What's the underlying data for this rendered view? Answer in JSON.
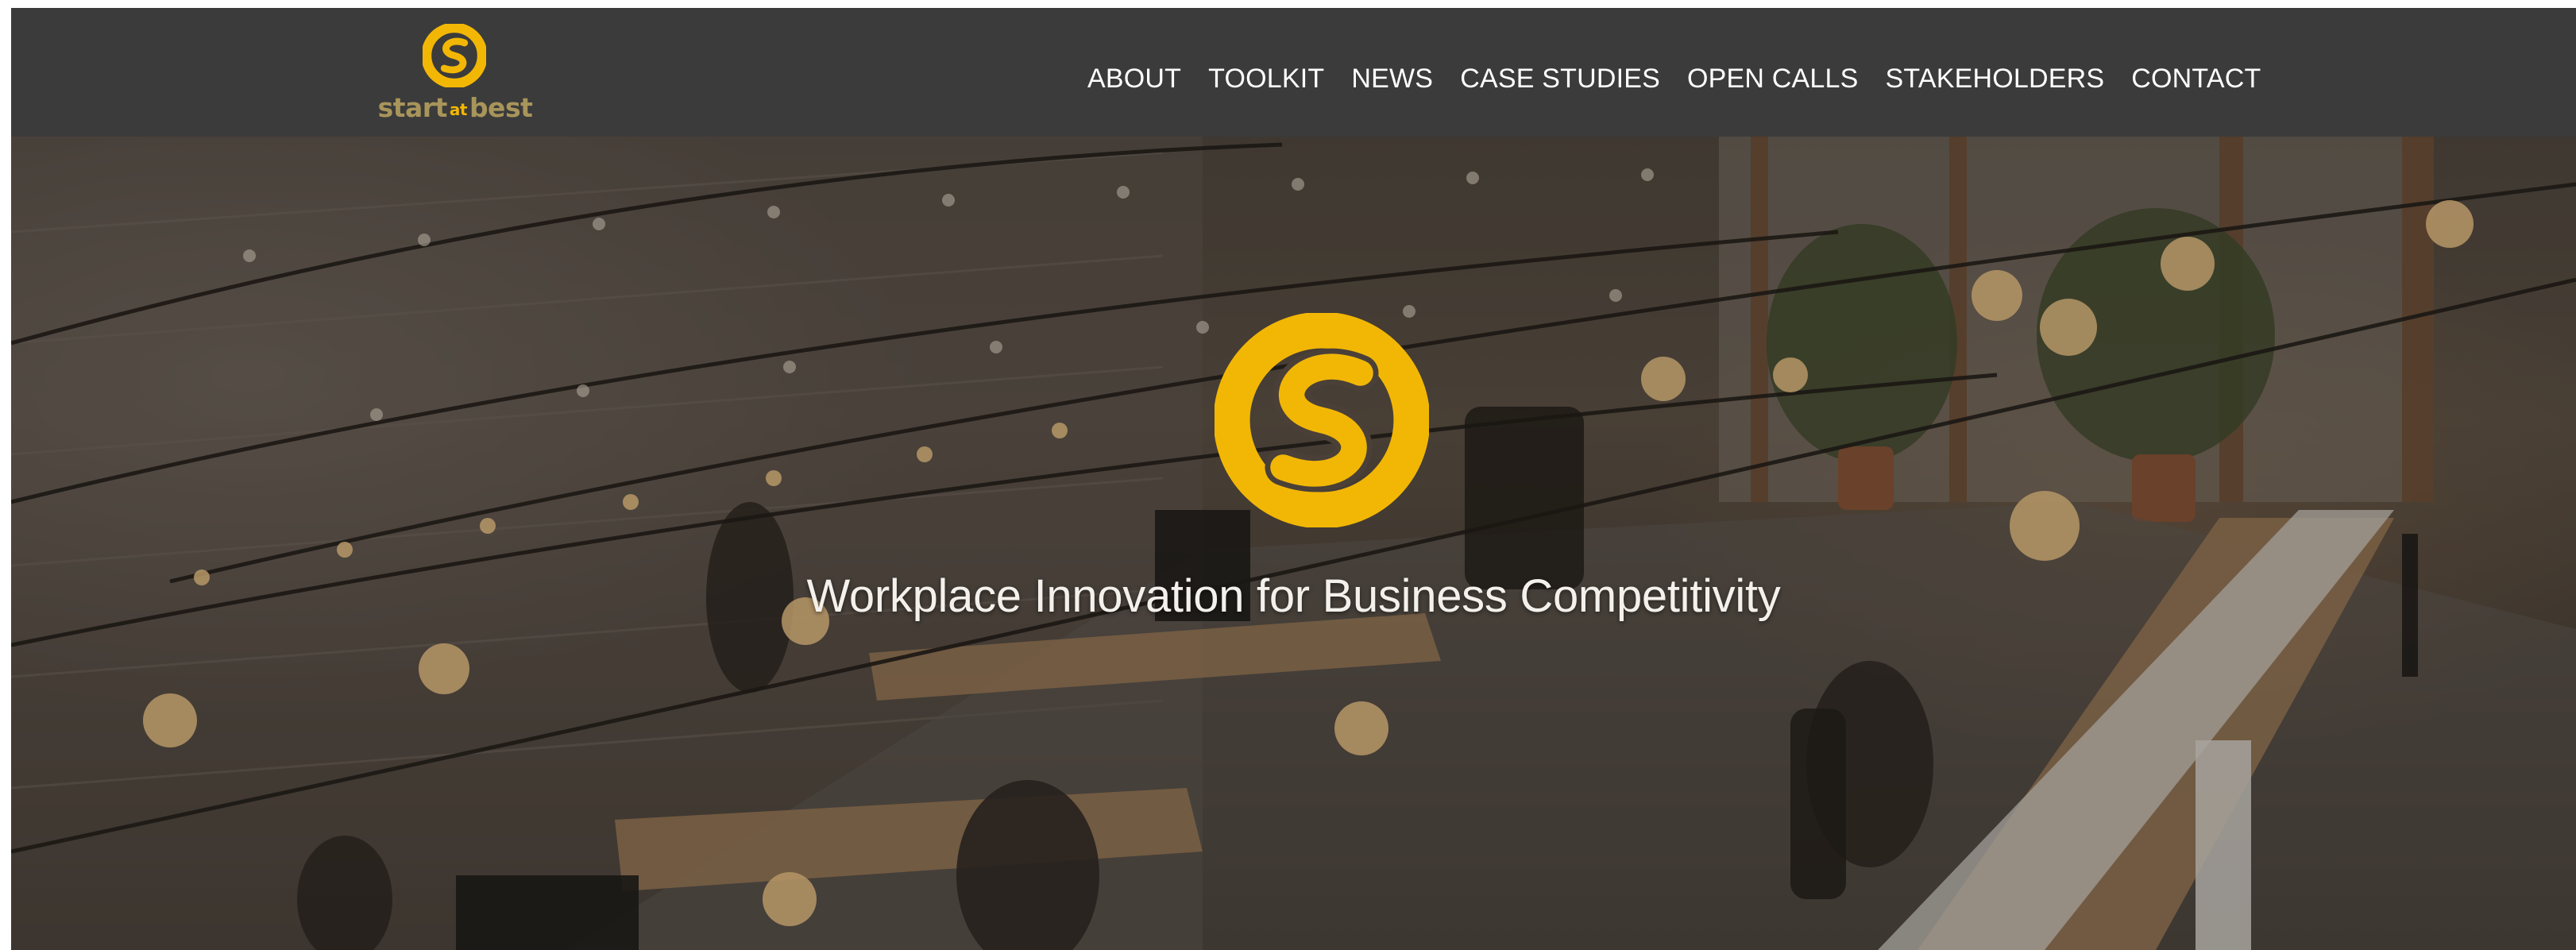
{
  "header": {
    "logo": {
      "wordmark_left": "start",
      "wordmark_mid": "at",
      "wordmark_right": "best",
      "icon": "s-swirl-logo-icon"
    },
    "nav": [
      {
        "label": "ABOUT"
      },
      {
        "label": "TOOLKIT"
      },
      {
        "label": "NEWS"
      },
      {
        "label": "CASE STUDIES"
      },
      {
        "label": "OPEN CALLS"
      },
      {
        "label": "STAKEHOLDERS"
      },
      {
        "label": "CONTACT"
      }
    ]
  },
  "hero": {
    "tagline": "Workplace Innovation for Business Competitivity",
    "icon": "s-swirl-logo-icon",
    "background": "coworking-office-photo"
  },
  "colors": {
    "topbar": "#3b3b3b",
    "brand_yellow": "#f2b705",
    "nav_text": "#ffffff"
  }
}
